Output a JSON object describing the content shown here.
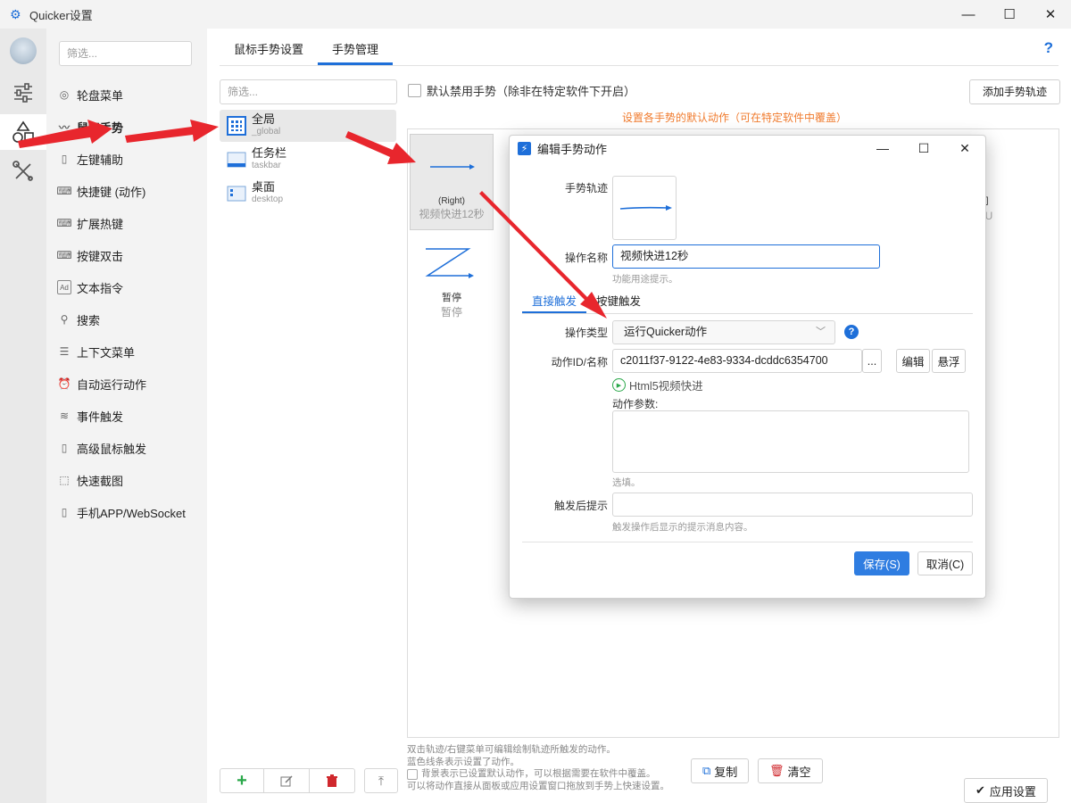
{
  "window": {
    "title": "Quicker设置",
    "min_glyph": "—",
    "max_glyph": "☐",
    "close_glyph": "✕"
  },
  "menu": {
    "filter_placeholder": "筛选...",
    "items": [
      {
        "label": "轮盘菜单",
        "icon": "wheel-icon",
        "glyph": "◎"
      },
      {
        "label": "鼠标手势",
        "icon": "mouse-gesture-icon",
        "glyph": "〰"
      },
      {
        "label": "左键辅助",
        "icon": "mouse-icon",
        "glyph": "▯"
      },
      {
        "label": "快捷键 (动作)",
        "icon": "keyboard-icon",
        "glyph": "⌨"
      },
      {
        "label": "扩展热键",
        "icon": "keyboard-icon",
        "glyph": "⌨"
      },
      {
        "label": "按键双击",
        "icon": "keyboard-icon",
        "glyph": "⌨"
      },
      {
        "label": "文本指令",
        "icon": "ad-icon",
        "glyph": "Ad"
      },
      {
        "label": "搜索",
        "icon": "search-icon",
        "glyph": "⚲"
      },
      {
        "label": "上下文菜单",
        "icon": "menu-lines-icon",
        "glyph": "☰"
      },
      {
        "label": "自动运行动作",
        "icon": "alarm-icon",
        "glyph": "⏰"
      },
      {
        "label": "事件触发",
        "icon": "event-icon",
        "glyph": "≋"
      },
      {
        "label": "高级鼠标触发",
        "icon": "mouse-icon",
        "glyph": "▯"
      },
      {
        "label": "快速截图",
        "icon": "screenshot-icon",
        "glyph": "⬚"
      },
      {
        "label": "手机APP/WebSocket",
        "icon": "phone-icon",
        "glyph": "▯"
      }
    ]
  },
  "tabs": [
    {
      "label": "鼠标手势设置"
    },
    {
      "label": "手势管理"
    }
  ],
  "help_label": "?",
  "scenes": {
    "filter_placeholder": "筛选...",
    "items": [
      {
        "name": "全局",
        "sub": "_global"
      },
      {
        "name": "任务栏",
        "sub": "taskbar"
      },
      {
        "name": "桌面",
        "sub": "desktop"
      }
    ]
  },
  "gestures": {
    "disable_label": "默认禁用手势（除非在特定软件下开启）",
    "add_track_label": "添加手势轨迹",
    "default_tip": "设置各手势的默认动作（可在特定软件中覆盖）",
    "cells": [
      {
        "name": "(Right)",
        "action": "视频快进12秒"
      },
      {
        "name": "暂停",
        "action": "暂停"
      }
    ],
    "hidden_fragments": [
      "司",
      "LU"
    ]
  },
  "notes": {
    "line1": "双击轨迹/右键菜单可编辑绘制轨迹所触发的动作。",
    "line2": "蓝色线条表示设置了动作。",
    "line3": "背景表示已设置默认动作，可以根据需要在软件中覆盖。",
    "line4": "可以将动作直接从面板或应用设置窗口拖放到手势上快速设置。"
  },
  "actions": {
    "copy": "复制",
    "clear": "清空",
    "apply": "应用设置"
  },
  "dialog": {
    "title": "编辑手势动作",
    "track_label": "手势轨迹",
    "name_label": "操作名称",
    "name_value": "视频快进12秒",
    "name_hint": "功能用途提示。",
    "tabs": [
      "直接触发",
      "按键触发"
    ],
    "type_label": "操作类型",
    "type_value": "运行Quicker动作",
    "id_label": "动作ID/名称",
    "id_value": "c2011f37-9122-4e83-9334-dcddc6354700",
    "more_btn": "...",
    "edit_btn": "编辑",
    "float_btn": "悬浮",
    "action_link": "Html5视频快进",
    "params_label": "动作参数:",
    "params_hint": "选填。",
    "tip_label": "触发后提示",
    "tip_hint": "触发操作后显示的提示消息内容。",
    "save_label": "保存(S)",
    "cancel_label": "取消(C)"
  },
  "colors": {
    "accent": "#1e6fd9",
    "orange": "#f07b2e",
    "arrow_red": "#e8262d"
  }
}
